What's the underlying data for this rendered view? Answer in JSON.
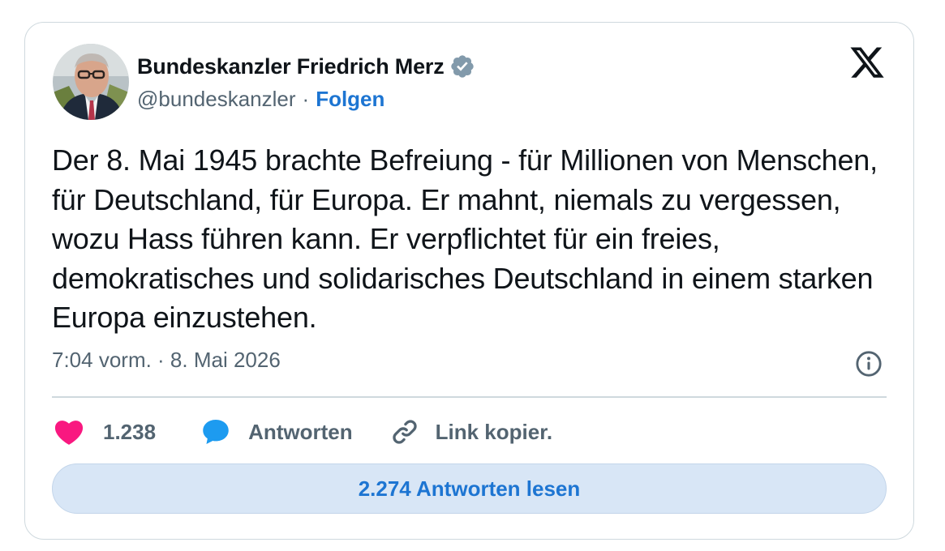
{
  "author": {
    "display_name": "Bundeskanzler Friedrich Merz",
    "handle": "@bundeskanzler",
    "separator": "·",
    "follow_label": "Folgen",
    "verified_color": "#829aab"
  },
  "tweet": {
    "text": "Der 8. Mai 1945 brachte Befreiung - für Millionen von Menschen, für Deutschland, für Europa. Er mahnt, niemals zu vergessen, wozu Hass führen kann. Er verpflichtet für ein freies, demokratisches und solidarisches Deutschland in einem starken Europa einzustehen.",
    "timestamp": "7:04 vorm. · 8. Mai 2026"
  },
  "actions": {
    "like_count": "1.238",
    "reply_label": "Antworten",
    "copy_link_label": "Link kopier."
  },
  "read_replies_label": "2.274 Antworten lesen",
  "icons": {
    "platform": "x-logo-icon",
    "verified": "verified-badge-icon",
    "info": "info-icon",
    "like": "heart-icon",
    "reply": "speech-bubble-icon",
    "copy_link": "link-icon"
  },
  "colors": {
    "accent": "#1d75d2",
    "like": "#f91880",
    "reply": "#1d9bf0",
    "button_bg": "#d8e6f6"
  }
}
